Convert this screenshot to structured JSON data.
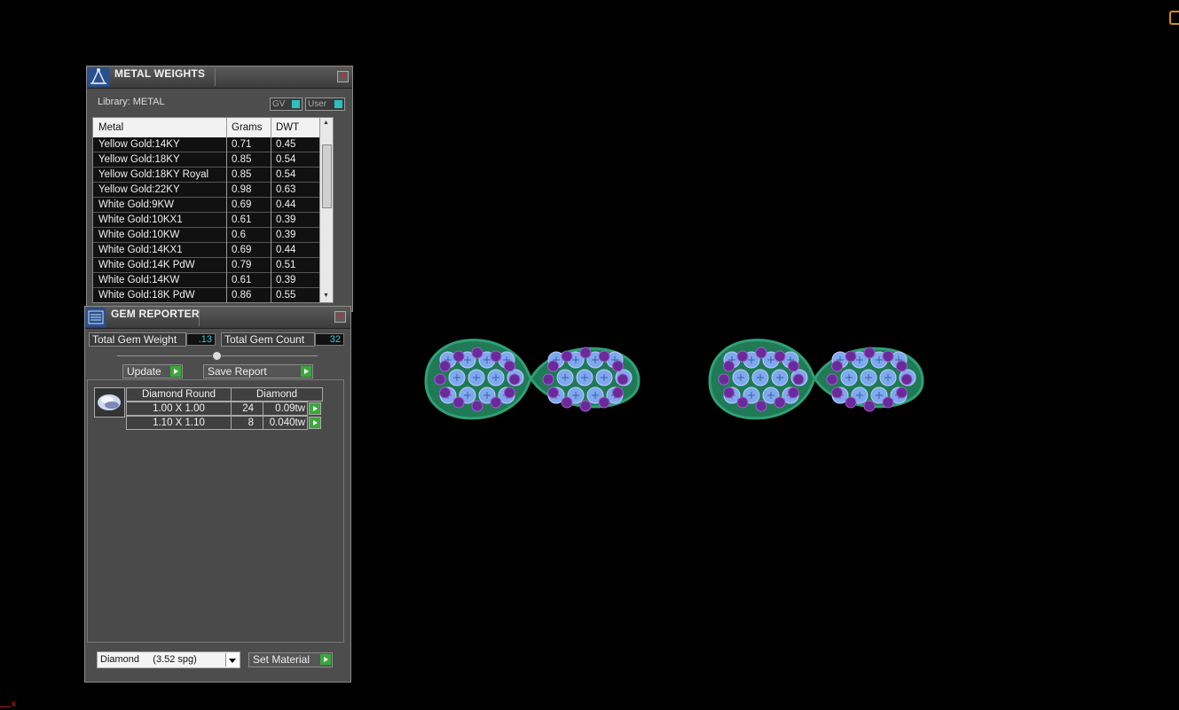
{
  "metal_weights": {
    "title": "METAL WEIGHTS",
    "library_label": "Library: METAL",
    "toggle_gv": "GV",
    "toggle_user": "User",
    "columns": [
      "Metal",
      "Grams",
      "DWT"
    ],
    "rows": [
      {
        "metal": "Yellow Gold:14KY",
        "grams": "0.71",
        "dwt": "0.45"
      },
      {
        "metal": "Yellow Gold:18KY",
        "grams": "0.85",
        "dwt": "0.54"
      },
      {
        "metal": "Yellow Gold:18KY Royal",
        "grams": "0.85",
        "dwt": "0.54"
      },
      {
        "metal": "Yellow Gold:22KY",
        "grams": "0.98",
        "dwt": "0.63"
      },
      {
        "metal": "White Gold:9KW",
        "grams": "0.69",
        "dwt": "0.44"
      },
      {
        "metal": "White Gold:10KX1",
        "grams": "0.61",
        "dwt": "0.39"
      },
      {
        "metal": "White Gold:10KW",
        "grams": "0.6",
        "dwt": "0.39"
      },
      {
        "metal": "White Gold:14KX1",
        "grams": "0.69",
        "dwt": "0.44"
      },
      {
        "metal": "White Gold:14K PdW",
        "grams": "0.79",
        "dwt": "0.51"
      },
      {
        "metal": "White Gold:14KW",
        "grams": "0.61",
        "dwt": "0.39"
      },
      {
        "metal": "White Gold:18K PdW",
        "grams": "0.86",
        "dwt": "0.55"
      }
    ]
  },
  "gem_reporter": {
    "title": "GEM REPORTER",
    "total_weight_label": "Total Gem Weight",
    "total_weight_value": ".13",
    "total_count_label": "Total Gem Count",
    "total_count_value": "32",
    "update_label": "Update",
    "save_report_label": "Save Report",
    "table_header_shape": "Diamond Round",
    "table_header_material": "Diamond",
    "rows": [
      {
        "size": "1.00 X 1.00",
        "count": "24",
        "weight": "0.09tw"
      },
      {
        "size": "1.10 X 1.10",
        "count": "8",
        "weight": "0.040tw"
      }
    ],
    "material_select": "Diamond     (3.52 spg)",
    "set_material_label": "Set Material"
  },
  "viewport": {
    "corner_marker": "x",
    "colors": {
      "band": "#1f7a55",
      "gem_blue": "#7fa9ee",
      "gem_purple": "#6b2a9a"
    }
  }
}
